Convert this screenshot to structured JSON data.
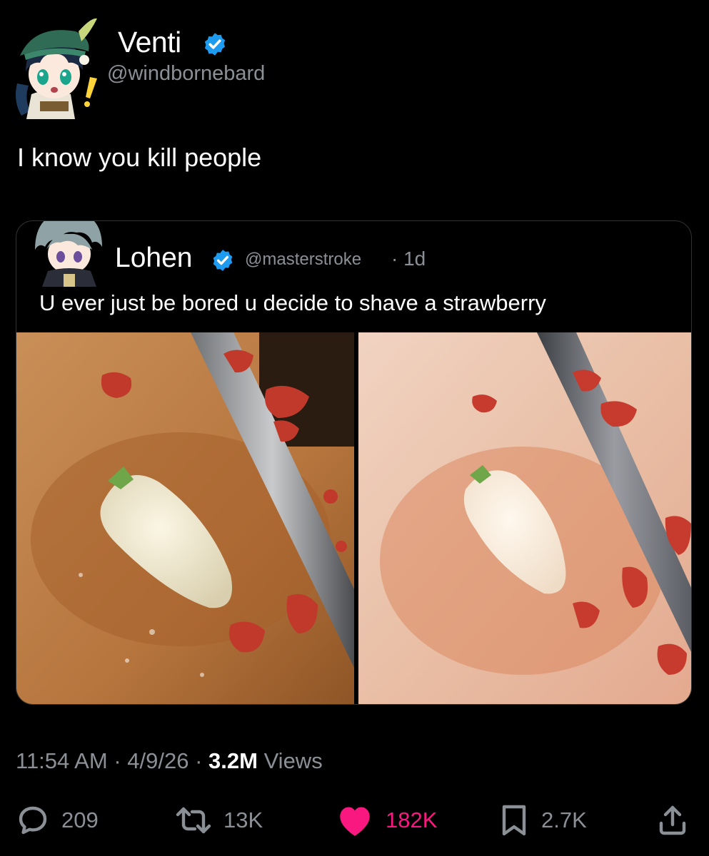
{
  "tweet": {
    "author": {
      "name": "Venti",
      "handle": "@windbornebard",
      "verified": true
    },
    "text": "I know you kill people",
    "time": "11:54 AM",
    "date": "4/9/26",
    "views_count": "3.2M",
    "views_label": "Views"
  },
  "quoted": {
    "author": {
      "name": "Lohen",
      "handle": "@masterstroke",
      "verified": true
    },
    "time": "· 1d",
    "text": "U ever just be bored u decide to shave a strawberry"
  },
  "actions": {
    "replies": "209",
    "reposts": "13K",
    "likes": "182K",
    "bookmarks": "2.7K"
  },
  "colors": {
    "background": "#000000",
    "verified": "#1d9bf0",
    "like": "#f91880",
    "secondary_text": "#8b9097"
  },
  "icons": [
    "reply-icon",
    "repost-icon",
    "like-icon",
    "bookmark-icon",
    "share-icon",
    "verified-icon"
  ]
}
